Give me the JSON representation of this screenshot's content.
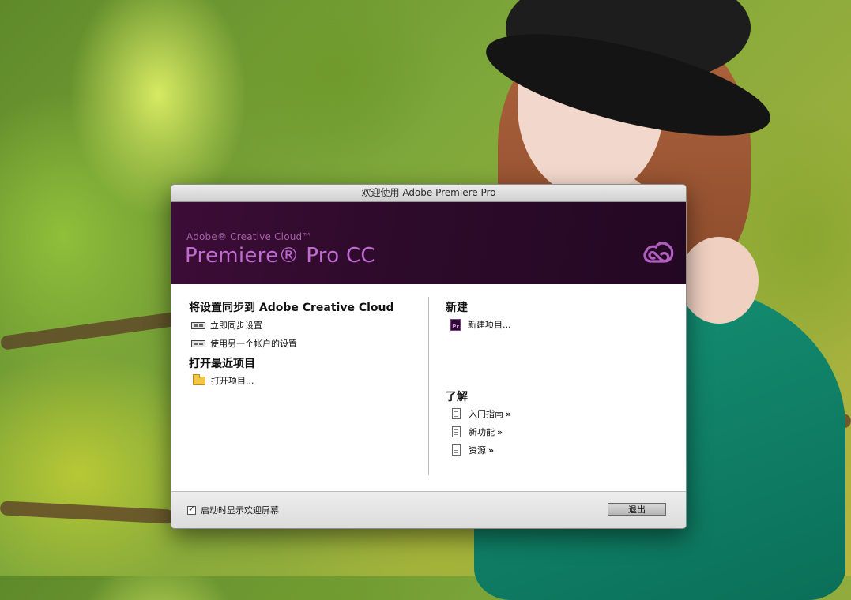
{
  "dialog": {
    "title": "欢迎使用 Adobe Premiere Pro",
    "brand_small": "Adobe® Creative Cloud™",
    "brand_large": "Premiere® Pro CC",
    "left": {
      "sync_title": "将设置同步到 Adobe Creative Cloud",
      "sync_now": "立即同步设置",
      "use_other_account": "使用另一个帐户的设置",
      "open_recent_title": "打开最近项目",
      "open_project": "打开项目..."
    },
    "right": {
      "new_title": "新建",
      "new_project": "新建项目...",
      "learn_title": "了解",
      "getting_started": "入门指南",
      "whats_new": "新功能",
      "resources": "资源",
      "arrow": "»"
    },
    "footer": {
      "show_on_startup": "启动时显示欢迎屏幕",
      "show_on_startup_checked": true,
      "exit_label": "退出"
    }
  },
  "colors": {
    "banner": "#2d0a2a",
    "brand_accent": "#c06bd1"
  }
}
